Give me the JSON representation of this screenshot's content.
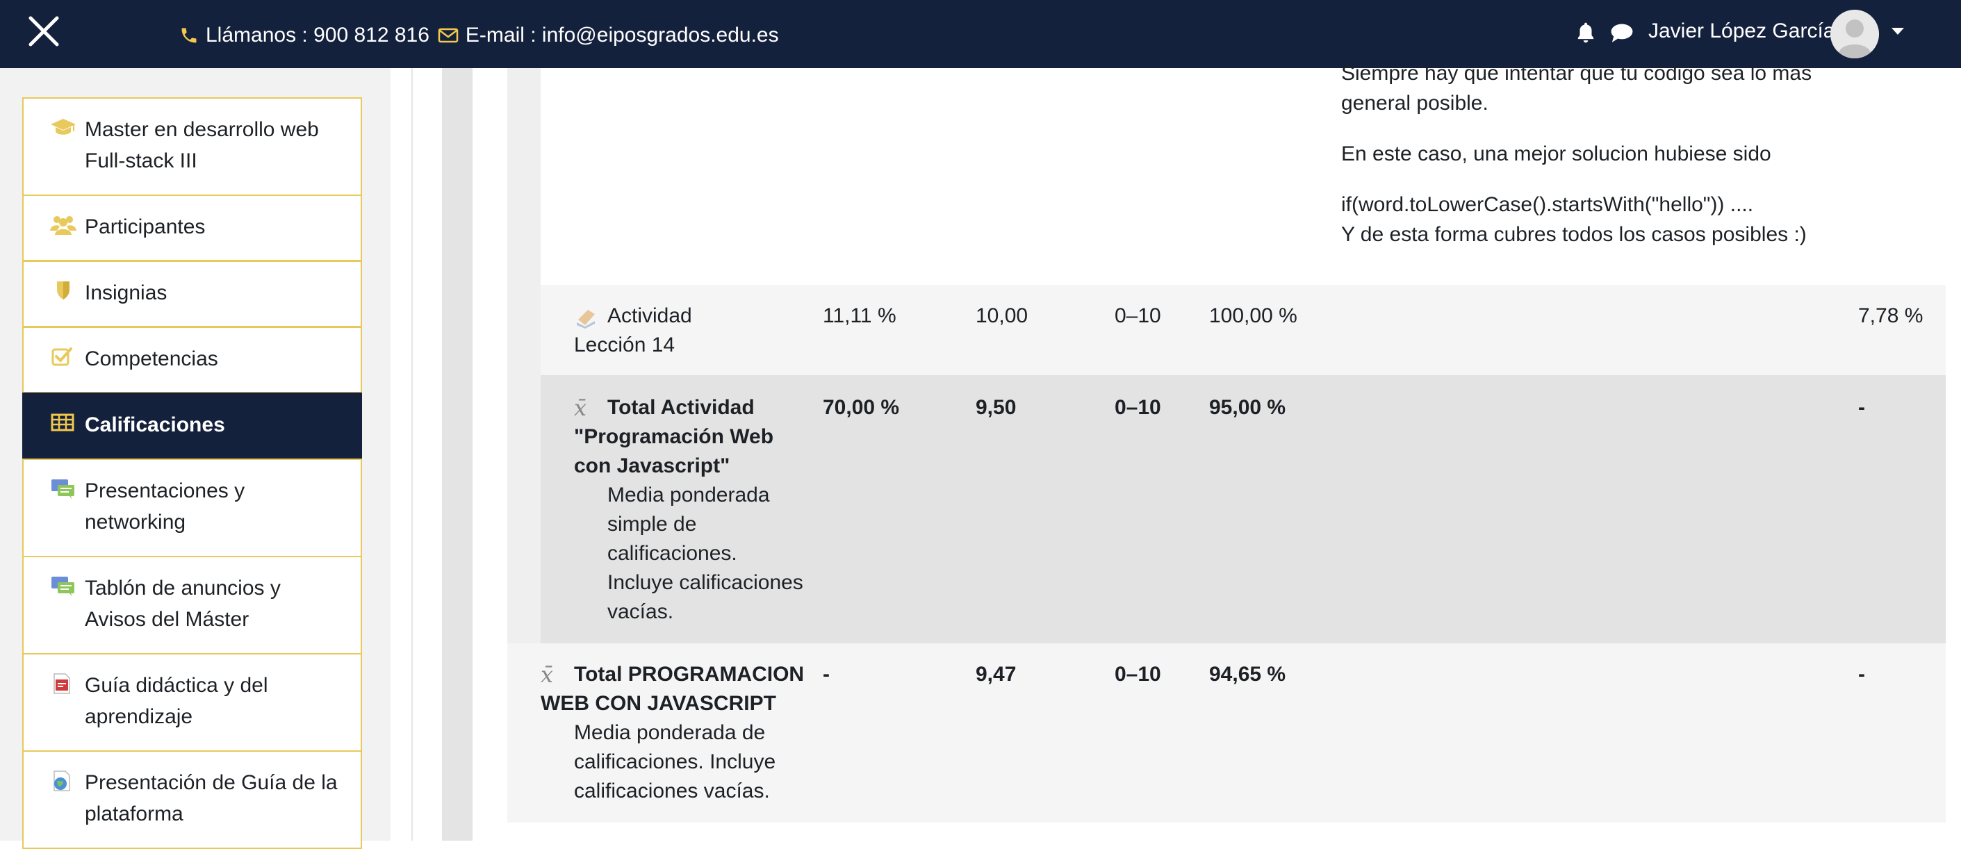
{
  "header": {
    "phone_label": "Llámanos : 900 812 816",
    "email_label": "E-mail : info@eiposgrados.edu.es",
    "user_name": "Javier López García"
  },
  "sidebar": {
    "items": [
      {
        "label": "Master en desarrollo web Full-stack III",
        "icon": "graduation-cap-icon"
      },
      {
        "label": "Participantes",
        "icon": "users-icon"
      },
      {
        "label": "Insignias",
        "icon": "shield-icon"
      },
      {
        "label": "Competencias",
        "icon": "checkbox-icon"
      },
      {
        "label": "Calificaciones",
        "icon": "table-icon",
        "active": true
      },
      {
        "label": "Presentaciones y networking",
        "icon": "forum-icon"
      },
      {
        "label": "Tablón de anuncios y Avisos del Máster",
        "icon": "forum-icon"
      },
      {
        "label": "Guía didáctica y del aprendizaje",
        "icon": "pdf-icon"
      },
      {
        "label": "Presentación de Guía de la plataforma",
        "icon": "globe-icon"
      }
    ]
  },
  "feedback": {
    "line1": "Siempre hay que intentar que tu código sea lo más general posible.",
    "line2": "En este caso, una mejor solucion hubiese sido",
    "line3": "if(word.toLowerCase().startsWith(\"hello\")) ....",
    "line4": "Y de esta forma cubres todos los casos posibles :)"
  },
  "grades": {
    "rows": [
      {
        "item": "Actividad Lección 14",
        "weight": "11,11 %",
        "grade": "10,00",
        "range": "0–10",
        "percentage": "100,00 %",
        "contribution": "7,78 %"
      },
      {
        "item": "Total Actividad \"Programación Web con Javascript\"",
        "description": "Media ponderada simple de calificaciones. Incluye calificaciones vacías.",
        "weight": "70,00 %",
        "grade": "9,50",
        "range": "0–10",
        "percentage": "95,00 %",
        "contribution": "-"
      },
      {
        "item": "Total PROGRAMACION WEB CON JAVASCRIPT",
        "description": "Media ponderada de calificaciones. Incluye calificaciones vacías.",
        "weight": "-",
        "grade": "9,47",
        "range": "0–10",
        "percentage": "94,65 %",
        "contribution": "-"
      }
    ]
  },
  "colors": {
    "navbar": "#14213d",
    "accent": "#e8c95c",
    "icon_gold": "#f2c94c"
  }
}
